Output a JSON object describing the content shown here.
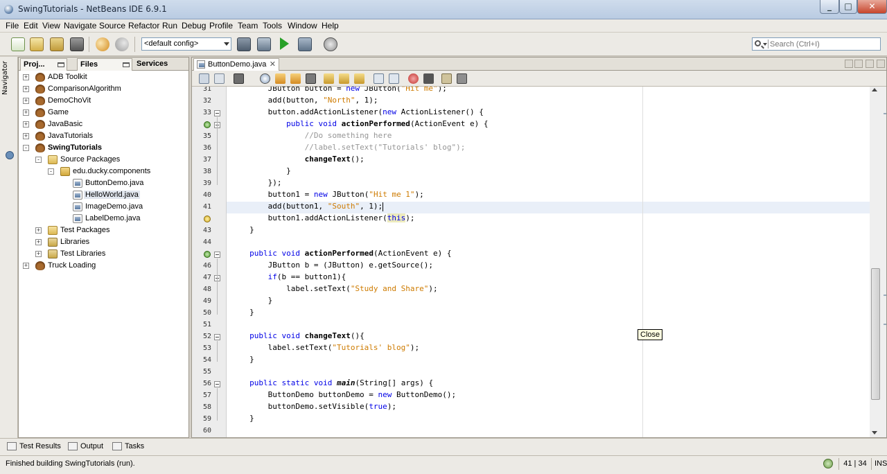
{
  "window": {
    "title": "SwingTutorials - NetBeans IDE 6.9.1"
  },
  "menu": [
    "File",
    "Edit",
    "View",
    "Navigate",
    "Source",
    "Refactor",
    "Run",
    "Debug",
    "Profile",
    "Team",
    "Tools",
    "Window",
    "Help"
  ],
  "toolbar": {
    "config": "<default config>",
    "search_placeholder": "Search (Ctrl+I)"
  },
  "navigator": {
    "label": "Navigator"
  },
  "project_panel": {
    "tabs": [
      "Proj...",
      "Files",
      "Services"
    ],
    "tree": [
      {
        "label": "ADB Toolkit",
        "depth": 0,
        "icon": "project-icon",
        "expander": "+"
      },
      {
        "label": "ComparisonAlgorithm",
        "depth": 0,
        "icon": "project-icon",
        "expander": "+"
      },
      {
        "label": "DemoChoVit",
        "depth": 0,
        "icon": "project-icon",
        "expander": "+"
      },
      {
        "label": "Game",
        "depth": 0,
        "icon": "project-icon",
        "expander": "+"
      },
      {
        "label": "JavaBasic",
        "depth": 0,
        "icon": "project-icon",
        "expander": "+"
      },
      {
        "label": "JavaTutorials",
        "depth": 0,
        "icon": "project-icon",
        "expander": "+"
      },
      {
        "label": "SwingTutorials",
        "depth": 0,
        "icon": "project-icon",
        "expander": "-",
        "bold": true
      },
      {
        "label": "Source Packages",
        "depth": 1,
        "icon": "source-packages-icon",
        "expander": "-"
      },
      {
        "label": "edu.ducky.components",
        "depth": 2,
        "icon": "package-icon",
        "expander": "-"
      },
      {
        "label": "ButtonDemo.java",
        "depth": 3,
        "icon": "java-file-icon",
        "expander": ""
      },
      {
        "label": "HelloWorld.java",
        "depth": 3,
        "icon": "java-file-icon",
        "expander": "",
        "selected": true
      },
      {
        "label": "ImageDemo.java",
        "depth": 3,
        "icon": "java-file-icon",
        "expander": ""
      },
      {
        "label": "LabelDemo.java",
        "depth": 3,
        "icon": "java-file-icon",
        "expander": ""
      },
      {
        "label": "Test Packages",
        "depth": 1,
        "icon": "test-packages-icon",
        "expander": "+"
      },
      {
        "label": "Libraries",
        "depth": 1,
        "icon": "libraries-icon",
        "expander": "+"
      },
      {
        "label": "Test Libraries",
        "depth": 1,
        "icon": "libraries-icon",
        "expander": "+"
      },
      {
        "label": "Truck Loading",
        "depth": 0,
        "icon": "project-icon",
        "expander": "+"
      }
    ]
  },
  "editor": {
    "tab_label": "ButtonDemo.java",
    "current_line": 41,
    "tooltip": "Close",
    "lines": [
      {
        "n": "31",
        "t": "        JButton button = new JButton(\"Hit me\");"
      },
      {
        "n": "32",
        "t": "        add(button, \"North\", 1);"
      },
      {
        "n": "33",
        "t": "        button.addActionListener(new ActionListener() {",
        "fold": true
      },
      {
        "n": "",
        "t": "            public void actionPerformed(ActionEvent e) {",
        "fold": true,
        "marker": "green"
      },
      {
        "n": "35",
        "t": "                //Do something here"
      },
      {
        "n": "36",
        "t": "                //label.setText(\"Tutorials' blog\");"
      },
      {
        "n": "37",
        "t": "                changeText();"
      },
      {
        "n": "38",
        "t": "            }"
      },
      {
        "n": "39",
        "t": "        });"
      },
      {
        "n": "40",
        "t": "        button1 = new JButton(\"Hit me 1\");"
      },
      {
        "n": "41",
        "t": "        add(button1, \"South\", 1);"
      },
      {
        "n": "",
        "t": "        button1.addActionListener(this);",
        "marker": "bulb"
      },
      {
        "n": "43",
        "t": "    }"
      },
      {
        "n": "44",
        "t": ""
      },
      {
        "n": "",
        "t": "    public void actionPerformed(ActionEvent e) {",
        "fold": true,
        "marker": "green"
      },
      {
        "n": "46",
        "t": "        JButton b = (JButton) e.getSource();"
      },
      {
        "n": "47",
        "t": "        if(b == button1){",
        "fold": true
      },
      {
        "n": "48",
        "t": "            label.setText(\"Study and Share\");"
      },
      {
        "n": "49",
        "t": "        }"
      },
      {
        "n": "50",
        "t": "    }"
      },
      {
        "n": "51",
        "t": ""
      },
      {
        "n": "52",
        "t": "    public void changeText(){",
        "fold": true
      },
      {
        "n": "53",
        "t": "        label.setText(\"Tutorials' blog\");"
      },
      {
        "n": "54",
        "t": "    }"
      },
      {
        "n": "55",
        "t": ""
      },
      {
        "n": "56",
        "t": "    public static void main(String[] args) {",
        "fold": true
      },
      {
        "n": "57",
        "t": "        ButtonDemo buttonDemo = new ButtonDemo();"
      },
      {
        "n": "58",
        "t": "        buttonDemo.setVisible(true);"
      },
      {
        "n": "59",
        "t": "    }"
      },
      {
        "n": "60",
        "t": ""
      }
    ]
  },
  "bottom_tabs": [
    "Test Results",
    "Output",
    "Tasks"
  ],
  "status": {
    "message": "Finished building SwingTutorials (run).",
    "position": "41 | 34",
    "mode": "INS"
  }
}
